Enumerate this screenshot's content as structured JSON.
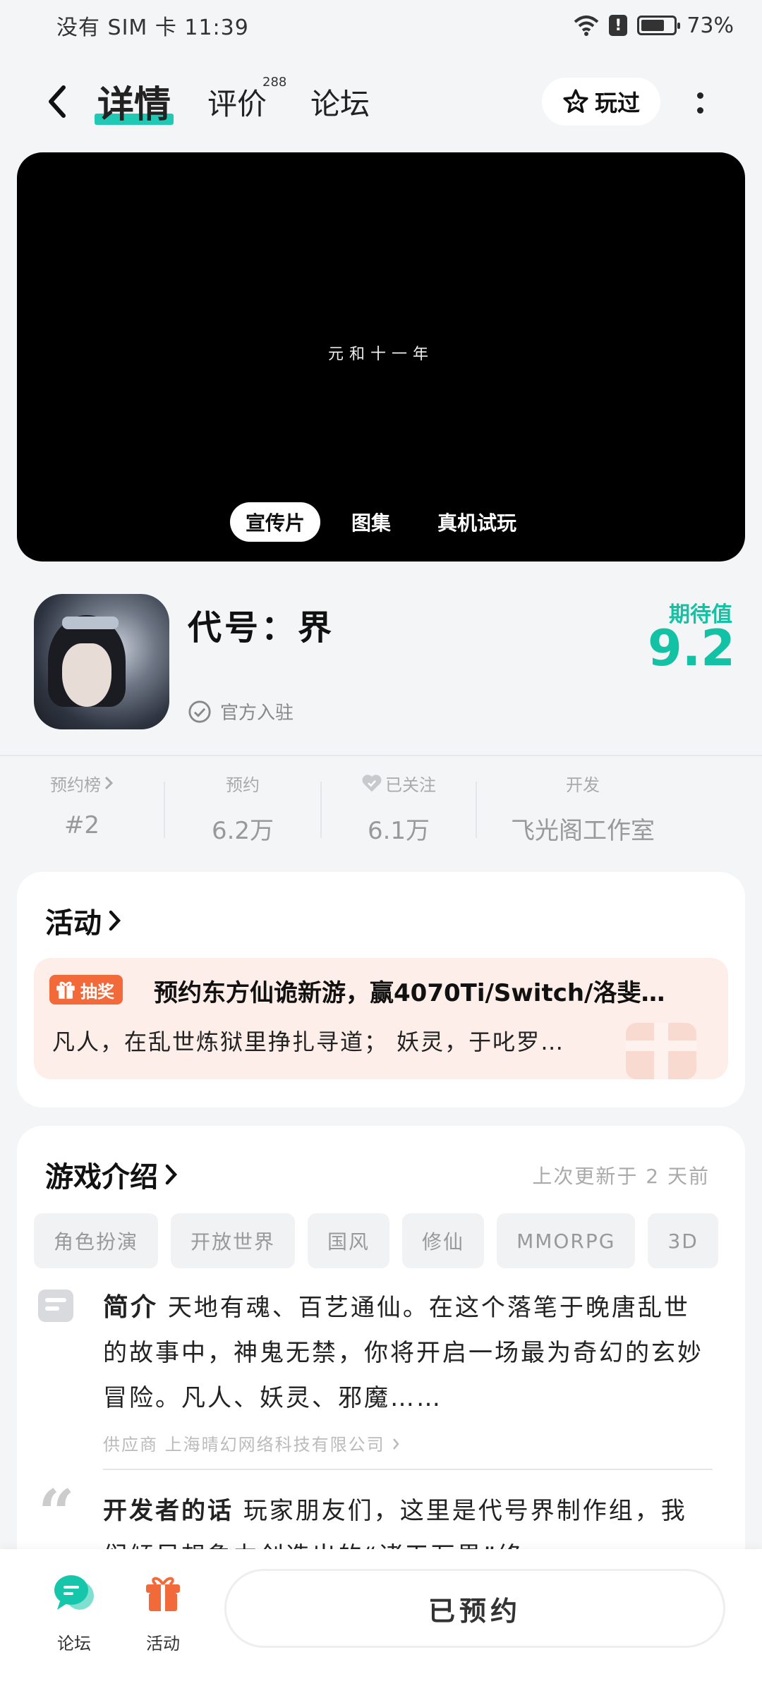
{
  "status_bar": {
    "carrier": "没有 SIM 卡 11:39",
    "battery_percent": "73%",
    "battery_level": 0.73,
    "alert_mark": "!"
  },
  "header": {
    "tabs": [
      {
        "label": "详情",
        "active": true
      },
      {
        "label": "评价",
        "badge": "288"
      },
      {
        "label": "论坛"
      }
    ],
    "played_label": "玩过"
  },
  "video": {
    "caption": "元和十一年",
    "media_tabs": [
      {
        "label": "宣传片",
        "active": true
      },
      {
        "label": "图集"
      },
      {
        "label": "真机试玩"
      }
    ]
  },
  "game": {
    "title": "代号：界",
    "official_label": "官方入驻",
    "expect_label": "期待值",
    "expect_score": "9.2"
  },
  "stats": [
    {
      "label": "预约榜",
      "value": "#2"
    },
    {
      "label": "预约",
      "value": "6.2万"
    },
    {
      "label": "已关注",
      "value": "6.1万"
    },
    {
      "label": "开发",
      "value": "飞光阁工作室"
    }
  ],
  "activity": {
    "section_title": "活动",
    "badge": "抽奖",
    "title": "预约东方仙诡新游，赢4070Ti/Switch/洛斐…",
    "desc": "凡人，在乱世炼狱里挣扎寻道；  妖灵，于叱罗…"
  },
  "intro": {
    "section_title": "游戏介绍",
    "updated": "上次更新于 2 天前",
    "tags": [
      "角色扮演",
      "开放世界",
      "国风",
      "修仙",
      "MMORPG",
      "3D"
    ],
    "summary_label": "简介",
    "summary": "天地有魂、百艺通仙。在这个落笔于晚唐乱世的故事中，神鬼无禁，你将开启一场最为奇幻的玄妙冒险。凡人、妖灵、邪魔……",
    "supplier": "供应商 上海晴幻网络科技有限公司",
    "dev_label": "开发者的话",
    "dev_text": "玩家朋友们，这里是代号界制作组，我们倾尽想象力创造出的“诸天万界”终"
  },
  "bottom_bar": {
    "forum_label": "论坛",
    "activity_label": "活动",
    "reserve_label": "已预约"
  },
  "colors": {
    "accent": "#13c2a4",
    "lottery": "#f26a3a"
  }
}
